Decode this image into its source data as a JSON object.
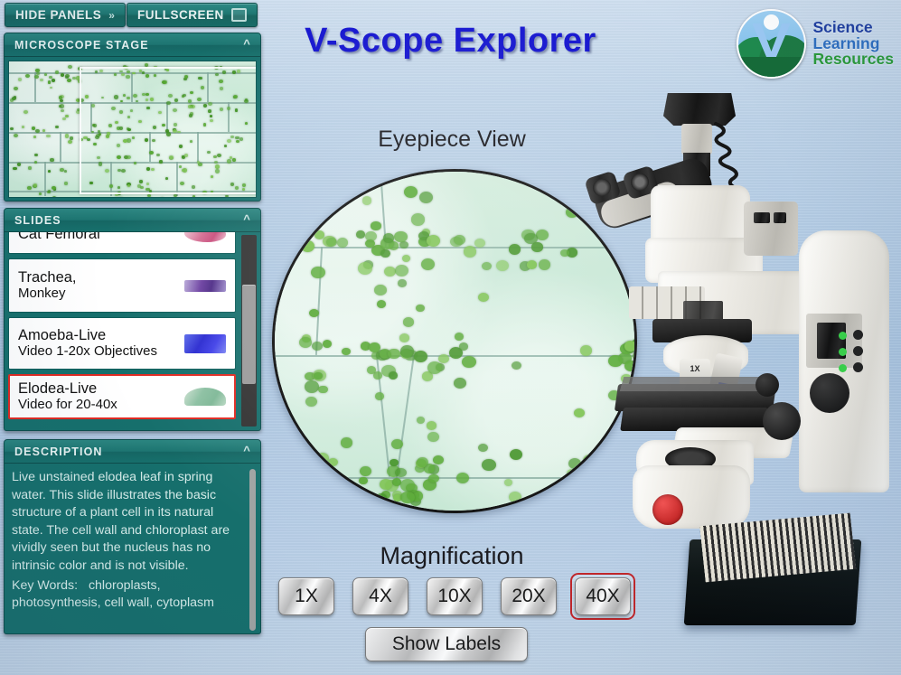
{
  "app": {
    "title": "V-Scope Explorer",
    "background_color": "#b6cde5"
  },
  "toolbar": {
    "hide_panels_label": "HIDE PANELS",
    "hide_panels_icon": "double-chevron-right-icon",
    "fullscreen_label": "FULLSCREEN",
    "fullscreen_icon": "square-expand-icon"
  },
  "logo": {
    "line1": "Science",
    "line2": "Learning",
    "line3": "Resources",
    "line1_color": "#1f3fa0",
    "line2_color": "#2f6fc0",
    "line3_color": "#2a9a3a",
    "mark": "circular-landscape-v-logo"
  },
  "panels": {
    "stage": {
      "title": "MICROSCOPE STAGE",
      "collapse_icon": "chevron-up-icon",
      "content": "elodea-leaf-cells-stage-view",
      "field_of_view_overlay": true
    },
    "slides": {
      "title": "SLIDES",
      "collapse_icon": "chevron-up-icon",
      "items": [
        {
          "title": "Cat Femoral",
          "subtitle": "",
          "thumb": "pink-tissue-thumbnail",
          "selected": false
        },
        {
          "title": "Trachea,",
          "subtitle": "Monkey",
          "thumb": "purple-tissue-thumbnail",
          "selected": false
        },
        {
          "title": "Amoeba-Live",
          "subtitle": "Video 1-20x Objectives",
          "thumb": "blue-amoeba-thumbnail",
          "selected": false
        },
        {
          "title": "Elodea-Live",
          "subtitle": "Video for 20-40x",
          "thumb": "green-elodea-thumbnail",
          "selected": true
        }
      ],
      "scrollbar": "vertical-scrollbar"
    },
    "description": {
      "title": "DESCRIPTION",
      "collapse_icon": "chevron-up-icon",
      "body": "Live unstained elodea leaf in spring water. This slide illustrates the basic structure of a plant cell in its natural state. The cell wall and chloroplast are vividly seen but the nucleus has no intrinsic color and is not visible.",
      "keywords_label": "Key Words:",
      "keywords": "chloroplasts, photosynthesis, cell wall, cytoplasm"
    }
  },
  "main": {
    "eyepiece_label": "Eyepiece View",
    "eyepiece_content": "elodea-cells-with-chloroplasts",
    "magnification_label": "Magnification",
    "magnification_options": [
      "1X",
      "4X",
      "10X",
      "20X",
      "40X"
    ],
    "magnification_selected": "40X",
    "selected_border_color": "#c0262a",
    "show_labels_label": "Show Labels"
  },
  "microscope": {
    "objective_label": "1X",
    "image": "trinocular-compound-microscope",
    "slide_box": "microscope-slide-storage-box"
  }
}
